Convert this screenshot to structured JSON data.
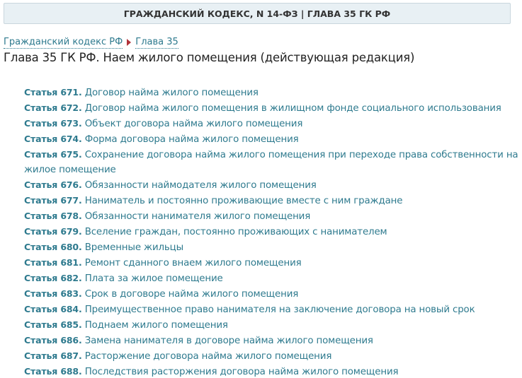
{
  "header": {
    "title": "ГРАЖДАНСКИЙ КОДЕКС, N 14-ФЗ | ГЛАВА 35 ГК РФ"
  },
  "breadcrumb": {
    "items": [
      {
        "label": "Гражданский кодекс РФ"
      },
      {
        "label": "Глава 35"
      }
    ]
  },
  "page_title": "Глава 35 ГК РФ. Наем жилого помещения (действующая редакция)",
  "articles": [
    {
      "num": "Статья 671.",
      "title": "Договор найма жилого помещения"
    },
    {
      "num": "Статья 672.",
      "title": "Договор найма жилого помещения в жилищном фонде социального использования"
    },
    {
      "num": "Статья 673.",
      "title": "Объект договора найма жилого помещения"
    },
    {
      "num": "Статья 674.",
      "title": "Форма договора найма жилого помещения"
    },
    {
      "num": "Статья 675.",
      "title": "Сохранение договора найма жилого помещения при переходе права собственности на жилое помещение"
    },
    {
      "num": "Статья 676.",
      "title": "Обязанности наймодателя жилого помещения"
    },
    {
      "num": "Статья 677.",
      "title": "Наниматель и постоянно проживающие вместе с ним граждане"
    },
    {
      "num": "Статья 678.",
      "title": "Обязанности нанимателя жилого помещения"
    },
    {
      "num": "Статья 679.",
      "title": "Вселение граждан, постоянно проживающих с нанимателем"
    },
    {
      "num": "Статья 680.",
      "title": "Временные жильцы"
    },
    {
      "num": "Статья 681.",
      "title": "Ремонт сданного внаем жилого помещения"
    },
    {
      "num": "Статья 682.",
      "title": "Плата за жилое помещение"
    },
    {
      "num": "Статья 683.",
      "title": "Срок в договоре найма жилого помещения"
    },
    {
      "num": "Статья 684.",
      "title": "Преимущественное право нанимателя на заключение договора на новый срок"
    },
    {
      "num": "Статья 685.",
      "title": "Поднаем жилого помещения"
    },
    {
      "num": "Статья 686.",
      "title": "Замена нанимателя в договоре найма жилого помещения"
    },
    {
      "num": "Статья 687.",
      "title": "Расторжение договора найма жилого помещения"
    },
    {
      "num": "Статья 688.",
      "title": "Последствия расторжения договора найма жилого помещения"
    }
  ],
  "colors": {
    "link": "#2e7a8e",
    "separator": "#b2333a",
    "header_bg": "#e8f0f4"
  }
}
